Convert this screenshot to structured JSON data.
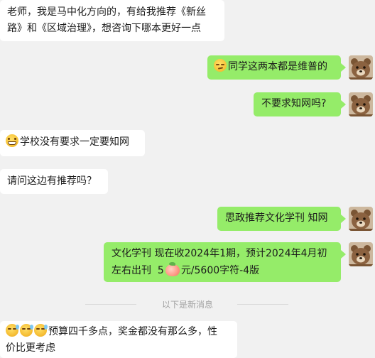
{
  "messages": [
    {
      "side": "in",
      "text_lines": [
        "老师，我是马中化方向的，有给我推荐《新丝",
        "路》和《区域治理》，想咨询下哪本更好一点"
      ]
    },
    {
      "side": "out",
      "emoji": "smirk-emoji",
      "text": "同学这两本都是维普的"
    },
    {
      "side": "out",
      "text": "不要求知网吗?"
    },
    {
      "side": "in",
      "emoji": "grin-emoji",
      "text": "学校没有要求一定要知网"
    },
    {
      "side": "in",
      "text": "请问这边有推荐吗？"
    },
    {
      "side": "out",
      "text": "思政推荐文化学刊 知网"
    },
    {
      "side": "out",
      "text_line1": "文化学刊 现在收2024年1期，预计2024年4月初",
      "text_line2_a": "左右出刊  5",
      "text_line2_b": "元/5600字符-4版",
      "emoji": "peach-emoji"
    },
    {
      "side": "in",
      "emojis": [
        "sweat-emoji",
        "sweat-emoji",
        "sweat-emoji"
      ],
      "text_line1": "预算四千多点，奖金都没有那么多，性",
      "text_line2": "价比更考虑"
    }
  ],
  "divider": {
    "label": "以下是新消息"
  },
  "colors": {
    "background": "#f1f1f1",
    "bubble_out": "#95ec69",
    "bubble_in": "#ffffff",
    "divider_text": "#a3a3a3"
  },
  "avatar": {
    "icon": "bear-avatar-icon"
  }
}
